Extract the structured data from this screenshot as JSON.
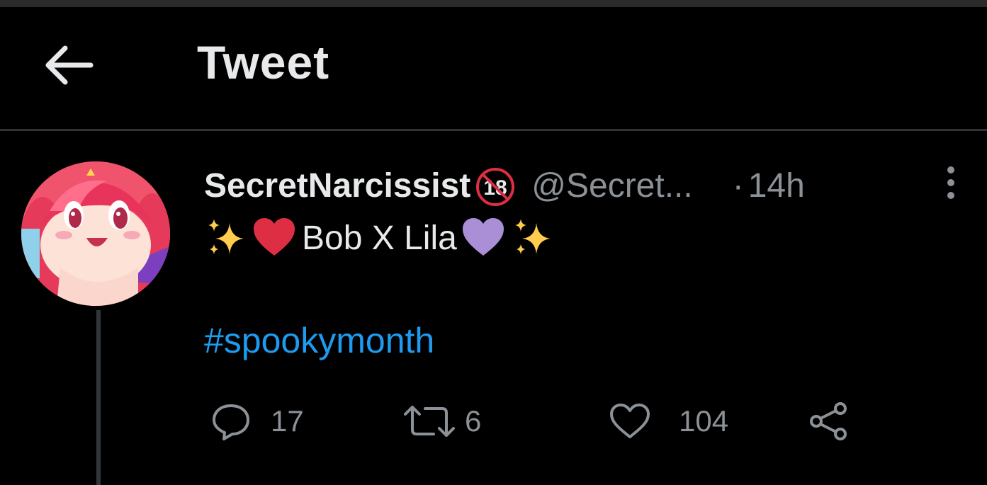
{
  "header": {
    "title": "Tweet",
    "back_icon": "arrow-left-icon"
  },
  "tweet": {
    "author": {
      "display_name": "SecretNarcissist",
      "badge": "18",
      "badge_icon": "no-under-18-icon",
      "handle": "@Secret...",
      "avatar_icon": "avatar-image"
    },
    "separator": "·",
    "time": "14h",
    "text": {
      "emoji_sparkles": "✨",
      "emoji_red_heart": "❤",
      "main": "Bob X Lila",
      "emoji_purple_heart": "💜"
    },
    "hashtag": "#spookymonth",
    "stats": {
      "replies": "17",
      "retweets": "6",
      "likes": "104"
    },
    "icons": {
      "reply": "reply-icon",
      "retweet": "retweet-icon",
      "like": "heart-icon",
      "share": "share-icon",
      "more": "more-options-icon"
    }
  },
  "colors": {
    "background": "#000000",
    "text": "#e7e9ea",
    "secondary": "#8b9196",
    "link": "#1d9bf0",
    "divider": "#2f3336",
    "red_heart": "#dd2e44",
    "purple_heart": "#aa8ed6",
    "sparkles": "#ffcc4d"
  }
}
